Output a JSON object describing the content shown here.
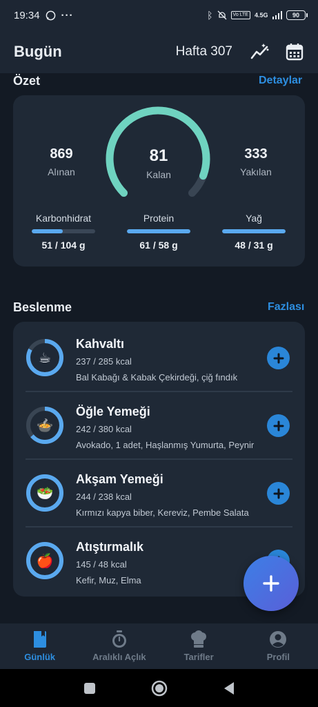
{
  "status_bar": {
    "time": "19:34",
    "network": "4.5G",
    "battery": "90"
  },
  "header": {
    "title": "Bugün",
    "week": "Hafta 307"
  },
  "summary": {
    "title": "Özet",
    "link": "Detaylar",
    "consumed": {
      "value": "869",
      "label": "Alınan"
    },
    "remaining": {
      "value": "81",
      "label": "Kalan"
    },
    "burned": {
      "value": "333",
      "label": "Yakılan"
    },
    "gauge_progress": 0.91,
    "macros": [
      {
        "name": "Karbonhidrat",
        "value": "51 / 104 g",
        "progress": 0.49
      },
      {
        "name": "Protein",
        "value": "61 / 58 g",
        "progress": 1.0
      },
      {
        "name": "Yağ",
        "value": "48 / 31 g",
        "progress": 1.0
      }
    ]
  },
  "nutrition": {
    "title": "Beslenme",
    "link": "Fazlası",
    "meals": [
      {
        "name": "Kahvaltı",
        "kcal": "237 / 285 kcal",
        "foods": "Bal Kabağı & Kabak Çekirdeği, çiğ fındık",
        "progress": 0.83,
        "icon": "coffee-icon",
        "emoji": "☕"
      },
      {
        "name": "Öğle Yemeği",
        "kcal": "242 / 380 kcal",
        "foods": "Avokado, 1 adet, Haşlanmış Yumurta, Peynir",
        "progress": 0.64,
        "icon": "soup-bowl-icon",
        "emoji": "🍲"
      },
      {
        "name": "Akşam Yemeği",
        "kcal": "244 / 238 kcal",
        "foods": "Kırmızı kapya biber, Kereviz, Pembe Salata",
        "progress": 1.0,
        "icon": "salad-icon",
        "emoji": "🥗"
      },
      {
        "name": "Atıştırmalık",
        "kcal": "145 / 48 kcal",
        "foods": "Kefir, Muz, Elma",
        "progress": 1.0,
        "icon": "apple-icon",
        "emoji": "🍎"
      }
    ]
  },
  "bottom_nav": [
    {
      "label": "Günlük",
      "icon": "diary-icon",
      "active": true
    },
    {
      "label": "Aralıklı Açlık",
      "icon": "stopwatch-icon",
      "active": false
    },
    {
      "label": "Tarifler",
      "icon": "chef-hat-icon",
      "active": false
    },
    {
      "label": "Profil",
      "icon": "profile-icon",
      "active": false
    }
  ],
  "colors": {
    "accent": "#2d8ee0",
    "gauge": "#6fd3c0",
    "ring": "#5aa9ef",
    "background": "#131a24",
    "card": "#1f2936"
  }
}
